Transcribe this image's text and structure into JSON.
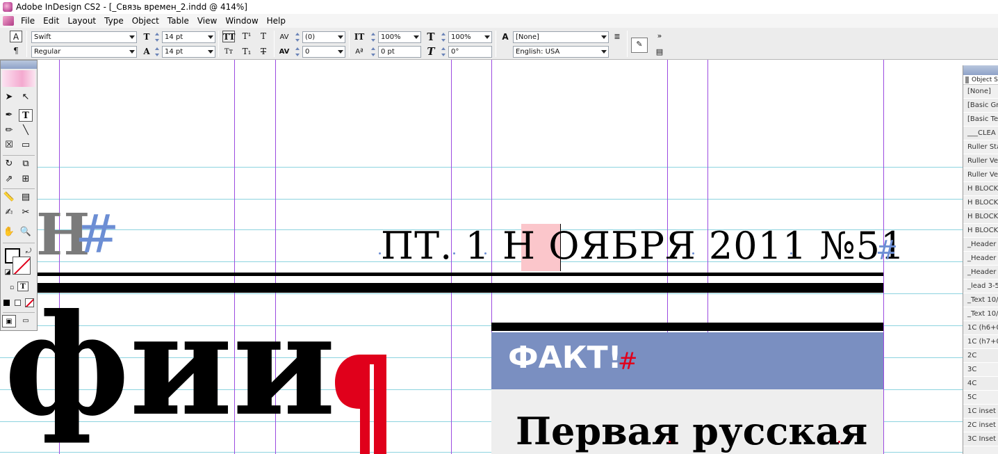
{
  "window": {
    "title": "Adobe InDesign CS2 - [_Связь времен_2.indd @ 414%]"
  },
  "menu": [
    "File",
    "Edit",
    "Layout",
    "Type",
    "Object",
    "Table",
    "View",
    "Window",
    "Help"
  ],
  "control_panel": {
    "font_family": "Swift",
    "font_style": "Regular",
    "font_size": "14 pt",
    "leading": "14 pt",
    "kerning": "(0)",
    "tracking": "0",
    "vertical_scale": "100%",
    "horizontal_scale": "100%",
    "baseline_shift": "0 pt",
    "skew": "0°",
    "character_style": "[None]",
    "language": "English: USA",
    "overflow": "»"
  },
  "document": {
    "issue_line": "ПТ. 1 Н   ОЯБРЯ 2011 №51",
    "left_heading_letter": "Н",
    "hash": "#",
    "fact_title": "ФАКТ!",
    "subheading": "Первая русская",
    "big_word": "фии"
  },
  "styles_panel": {
    "tab_label": "Object S",
    "items": [
      "[None]",
      "[Basic Gra",
      "[Basic Te",
      "___CLEA",
      "Ruller Sta",
      "Ruller Ver",
      "Ruller Ver",
      "H BLOCK",
      "H BLOCK",
      "H BLOCK",
      "H BLOCK",
      "_Header",
      "_Header",
      "_Header",
      "_lead 3-5",
      "_Text 10/",
      "_Text 10/",
      "1C (h6+0",
      "1C (h7+0",
      "2C",
      "3C",
      "4C",
      "5C",
      "1C inset s",
      "2C inset s",
      "3C Inset s"
    ]
  },
  "colors": {
    "fact_box": "#7a8fc1",
    "highlight": "#fbc6cb",
    "guide_cyan": "#8cd3df",
    "guide_violet": "#9b4ae0",
    "accent_red": "#e0001b",
    "hash_blue": "#6c8ed4"
  }
}
